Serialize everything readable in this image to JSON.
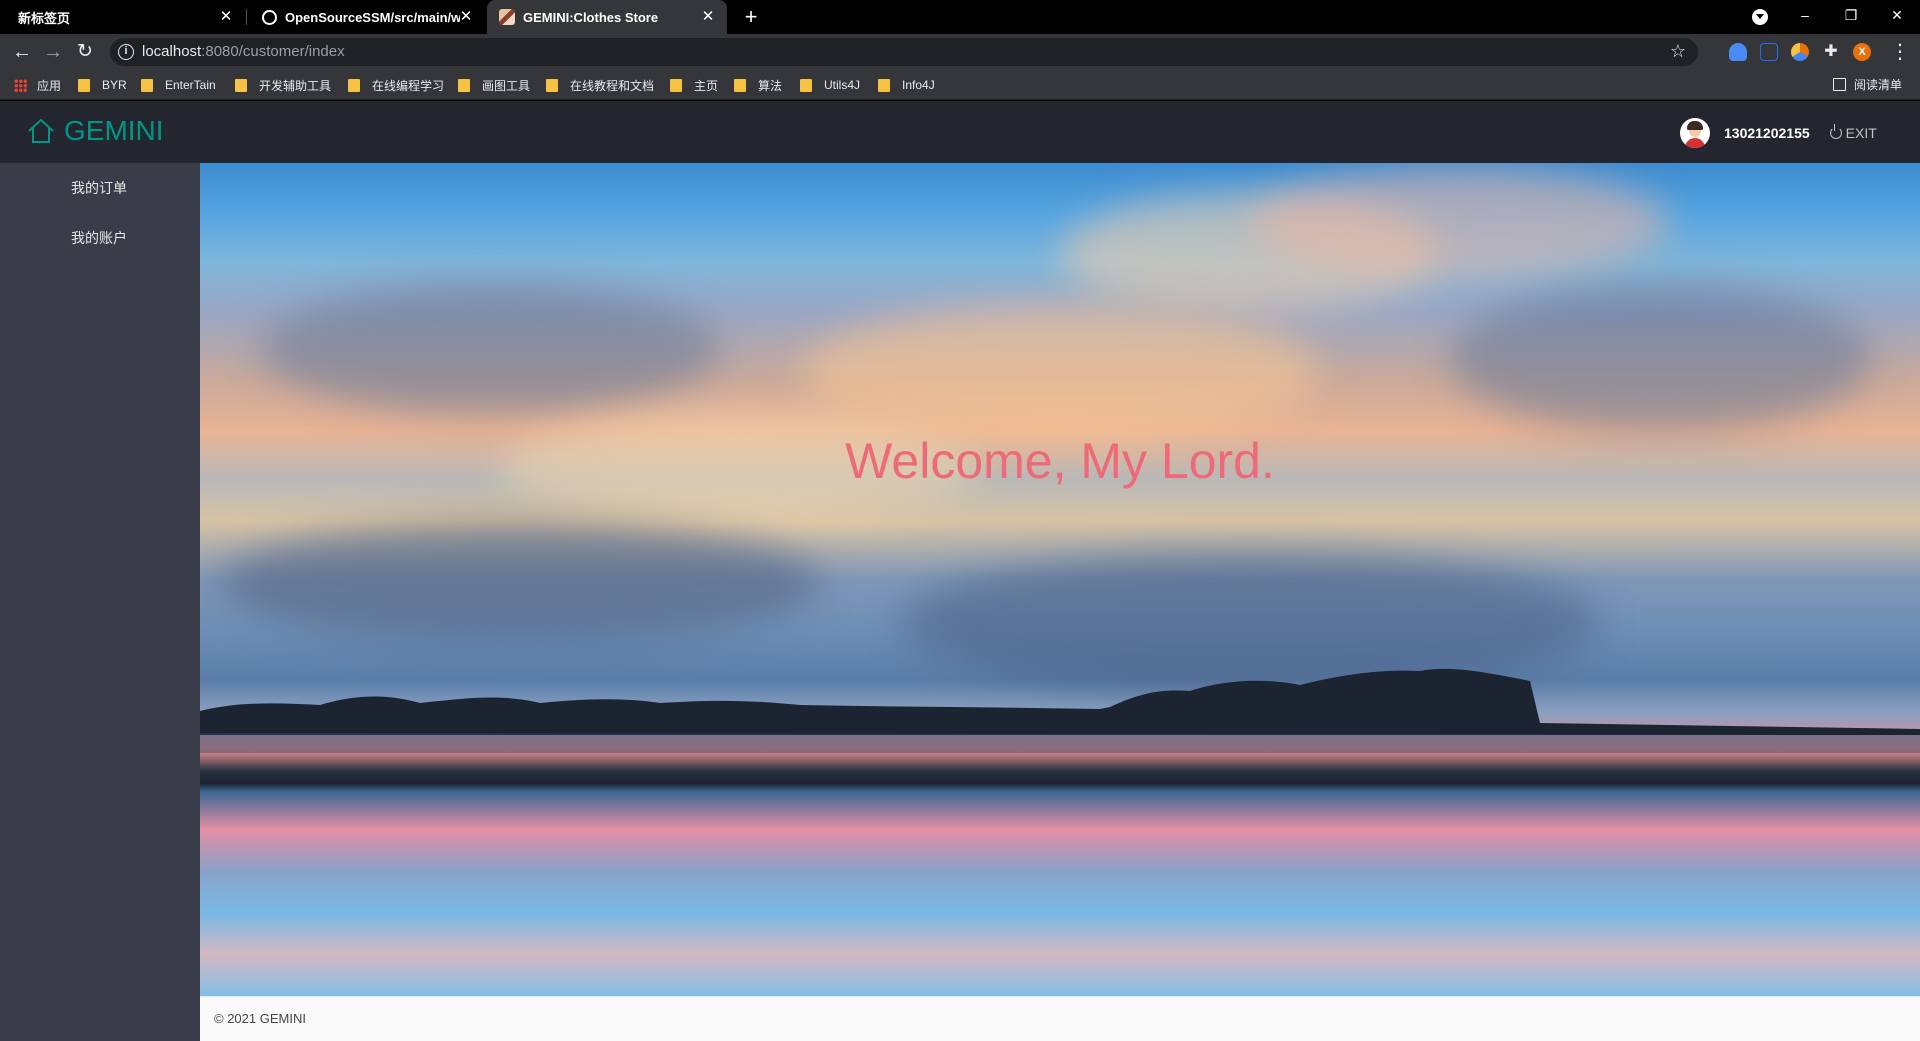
{
  "browser": {
    "tabs": [
      {
        "title": "新标签页"
      },
      {
        "title": "OpenSourceSSM/src/main/we"
      },
      {
        "title": "GEMINI:Clothes Store"
      }
    ],
    "new_tab": "+",
    "window_controls": {
      "minimize": "–",
      "restore": "❐",
      "close": "✕"
    },
    "url_host": "localhost",
    "url_rest": ":8080/customer/index",
    "extension_letter": "X",
    "bookmarks": [
      "应用",
      "BYR",
      "EnterTain",
      "开发辅助工具",
      "在线编程学习",
      "画图工具",
      "在线教程和文档",
      "主页",
      "算法",
      "Utils4J",
      "Info4J"
    ],
    "reading_list": "阅读清单"
  },
  "header": {
    "logo_text": "GEMINI",
    "username": "13021202155",
    "exit_label": "EXIT"
  },
  "sidebar": {
    "items": [
      {
        "label": "我的订单"
      },
      {
        "label": "我的账户"
      }
    ]
  },
  "main": {
    "welcome": "Welcome, My Lord."
  },
  "footer": {
    "copyright": "© 2021 GEMINI"
  },
  "colors": {
    "accent": "#009688",
    "header_bg": "#23262e",
    "sidebar_bg": "#393d49",
    "welcome_text": "#ed6b78"
  }
}
